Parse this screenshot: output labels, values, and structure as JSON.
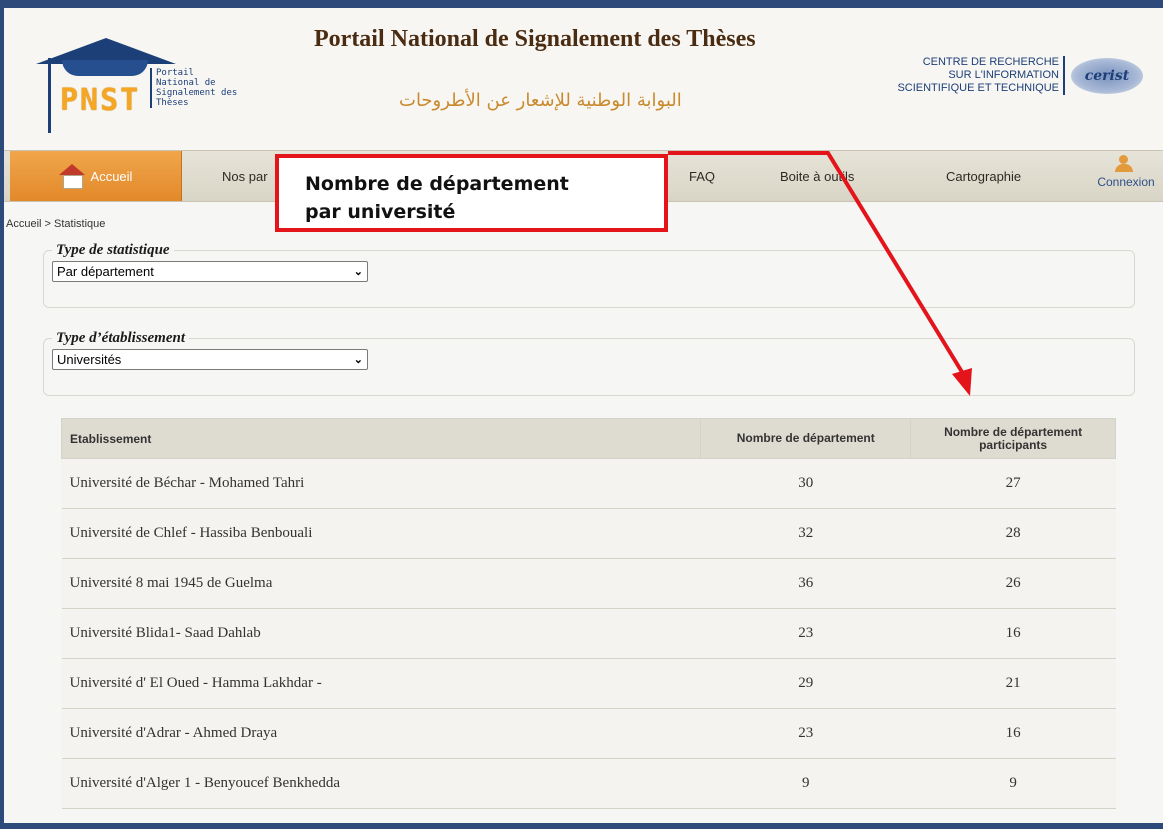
{
  "header": {
    "title": "Portail National de Signalement des Thèses",
    "title_ar": "البوابة الوطنية للإشعار عن الأطروحات",
    "logo": {
      "acronym": "PNST",
      "subtitle": "Portail National de Signalement des Thèses"
    },
    "partner": {
      "line1": "CENTRE DE RECHERCHE",
      "line2": "SUR L'INFORMATION",
      "line3": "SCIENTIFIQUE ET TECHNIQUE",
      "brand": "cerist"
    }
  },
  "nav": {
    "items": [
      {
        "label": "Accueil",
        "active": true
      },
      {
        "label": "Nos par"
      },
      {
        "label": "FAQ"
      },
      {
        "label": "Boite à outils"
      },
      {
        "label": "Cartographie"
      }
    ],
    "connexion": "Connexion"
  },
  "callout": {
    "line1": "Nombre de département",
    "line2": "par université"
  },
  "breadcrumb": "Accueil > Statistique",
  "filters": {
    "stat_type": {
      "legend": "Type de statistique",
      "value": "Par département"
    },
    "estab_type": {
      "legend": "Type d’établissement",
      "value": "Universités"
    }
  },
  "table": {
    "headers": [
      "Etablissement",
      "Nombre de département",
      "Nombre de département participants"
    ],
    "rows": [
      {
        "name": "Université de Béchar - Mohamed Tahri",
        "dept": "30",
        "part": "27"
      },
      {
        "name": "Université de Chlef - Hassiba Benbouali",
        "dept": "32",
        "part": "28"
      },
      {
        "name": "Université 8 mai 1945 de Guelma",
        "dept": "36",
        "part": "26"
      },
      {
        "name": "Université Blida1- Saad Dahlab",
        "dept": "23",
        "part": "16"
      },
      {
        "name": "Université d' El Oued - Hamma Lakhdar -",
        "dept": "29",
        "part": "21"
      },
      {
        "name": "Université d'Adrar - Ahmed Draya",
        "dept": "23",
        "part": "16"
      },
      {
        "name": "Université d'Alger 1 - Benyoucef Benkhedda",
        "dept": "9",
        "part": "9"
      }
    ]
  },
  "colors": {
    "frame": "#2e4a7a",
    "accent": "#e2892a",
    "callout": "#e4141b"
  }
}
